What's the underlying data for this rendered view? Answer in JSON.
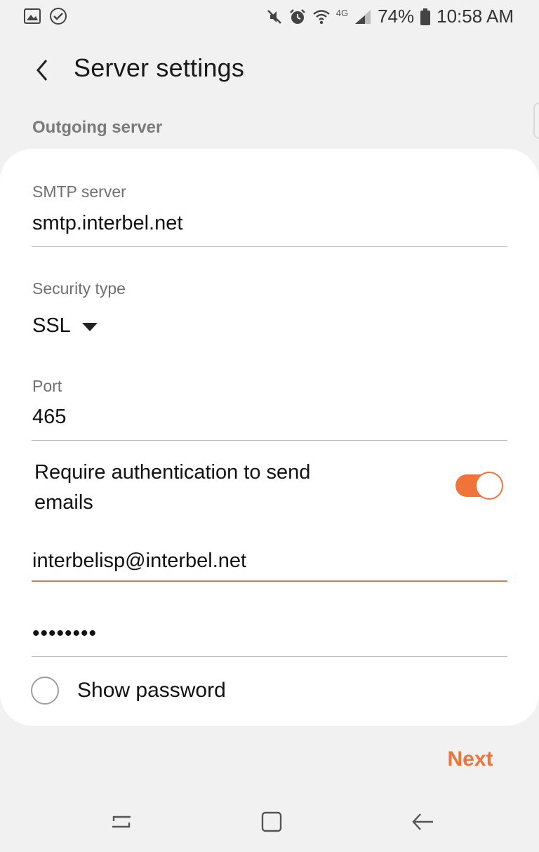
{
  "status_bar": {
    "battery": "74%",
    "time": "10:58 AM",
    "network": "4G"
  },
  "header": {
    "title": "Server settings"
  },
  "section": {
    "label": "Outgoing server"
  },
  "smtp": {
    "label": "SMTP server",
    "value": "smtp.interbel.net"
  },
  "security": {
    "label": "Security type",
    "selected": "SSL"
  },
  "port": {
    "label": "Port",
    "value": "465"
  },
  "auth": {
    "label": "Require authentication to send emails",
    "enabled": true
  },
  "username": {
    "value": "interbelisp@interbel.net"
  },
  "password": {
    "masked": "••••••••"
  },
  "show_password": {
    "label": "Show password",
    "checked": false
  },
  "next_label": "Next",
  "colors": {
    "accent": "#f07339",
    "background": "#f1f1f1",
    "card": "#ffffff"
  },
  "icons": {
    "status_left": [
      "gallery-icon",
      "check-circle-icon"
    ],
    "status_right": [
      "mute-icon",
      "alarm-icon",
      "wifi-icon",
      "signal-icon",
      "battery-icon"
    ],
    "nav": [
      "recents-icon",
      "home-icon",
      "back-icon"
    ]
  }
}
